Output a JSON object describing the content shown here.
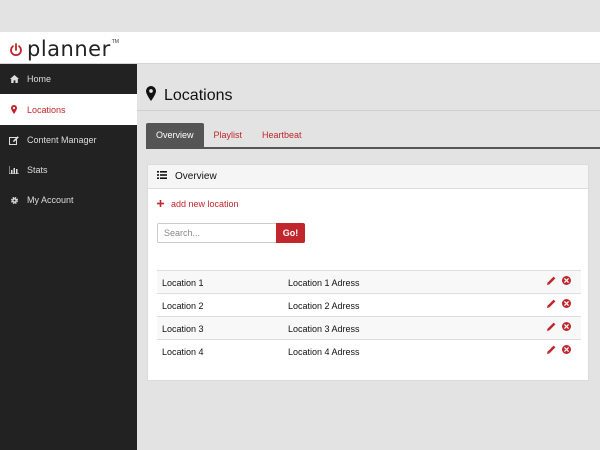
{
  "app": {
    "logo_text": "planner",
    "trademark": "TM",
    "accent_color": "#c0262c",
    "sidebar_color": "#222222"
  },
  "sidebar": {
    "items": [
      {
        "label": "Home",
        "icon": "home-icon"
      },
      {
        "label": "Locations",
        "icon": "map-marker-icon",
        "active": true
      },
      {
        "label": "Content Manager",
        "icon": "edit-icon"
      },
      {
        "label": "Stats",
        "icon": "bar-chart-icon"
      },
      {
        "label": "My Account",
        "icon": "gear-icon"
      }
    ]
  },
  "page": {
    "title": "Locations",
    "title_icon": "map-marker-icon"
  },
  "tabs": [
    {
      "label": "Overview",
      "active": true
    },
    {
      "label": "Playlist"
    },
    {
      "label": "Heartbeat"
    }
  ],
  "panel": {
    "heading": "Overview",
    "heading_icon": "list-icon",
    "add_link": "add new location",
    "add_icon": "plus-icon",
    "search_placeholder": "Search...",
    "search_button": "Go!"
  },
  "locations": [
    {
      "name": "Location 1",
      "address": "Location 1 Adress"
    },
    {
      "name": "Location 2",
      "address": "Location 2 Adress"
    },
    {
      "name": "Location 3",
      "address": "Location 3 Adress"
    },
    {
      "name": "Location 4",
      "address": "Location 4 Adress"
    }
  ],
  "row_actions": [
    "pencil-icon",
    "delete-circle-icon"
  ]
}
